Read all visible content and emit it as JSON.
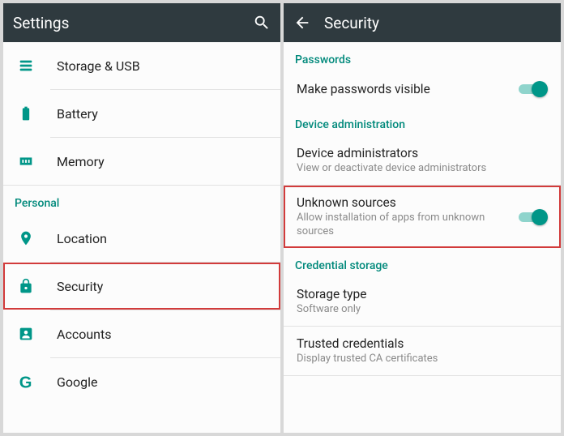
{
  "colors": {
    "accent": "#009688",
    "appbar": "#2f3a3f",
    "highlight": "#d23b3b"
  },
  "left": {
    "title": "Settings",
    "items": {
      "storage": "Storage & USB",
      "battery": "Battery",
      "memory": "Memory",
      "location": "Location",
      "security": "Security",
      "accounts": "Accounts",
      "google": "Google"
    },
    "section_personal": "Personal"
  },
  "right": {
    "title": "Security",
    "sections": {
      "passwords": "Passwords",
      "device_admin": "Device administration",
      "cred_storage": "Credential storage"
    },
    "make_passwords_visible": {
      "title": "Make passwords visible",
      "on": true
    },
    "device_administrators": {
      "title": "Device administrators",
      "sub": "View or deactivate device administrators"
    },
    "unknown_sources": {
      "title": "Unknown sources",
      "sub": "Allow installation of apps from unknown sources",
      "on": true
    },
    "storage_type": {
      "title": "Storage type",
      "sub": "Software only"
    },
    "trusted_credentials": {
      "title": "Trusted credentials",
      "sub": "Display trusted CA certificates"
    }
  }
}
